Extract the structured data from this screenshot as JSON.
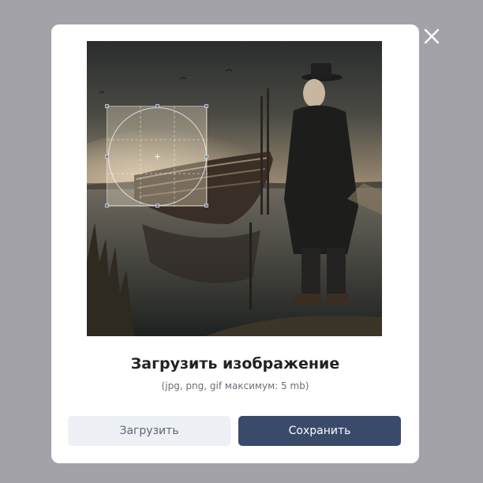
{
  "modal": {
    "title": "Загрузить изображение",
    "subtitle": "(jpg, png, gif максимум: 5 mb)",
    "upload_label": "Загрузить",
    "save_label": "Сохранить"
  },
  "icons": {
    "close": "close-icon"
  },
  "colors": {
    "overlay": "#a3a2a8",
    "save_button": "#3a4a6a",
    "upload_button": "#edf0f4"
  }
}
